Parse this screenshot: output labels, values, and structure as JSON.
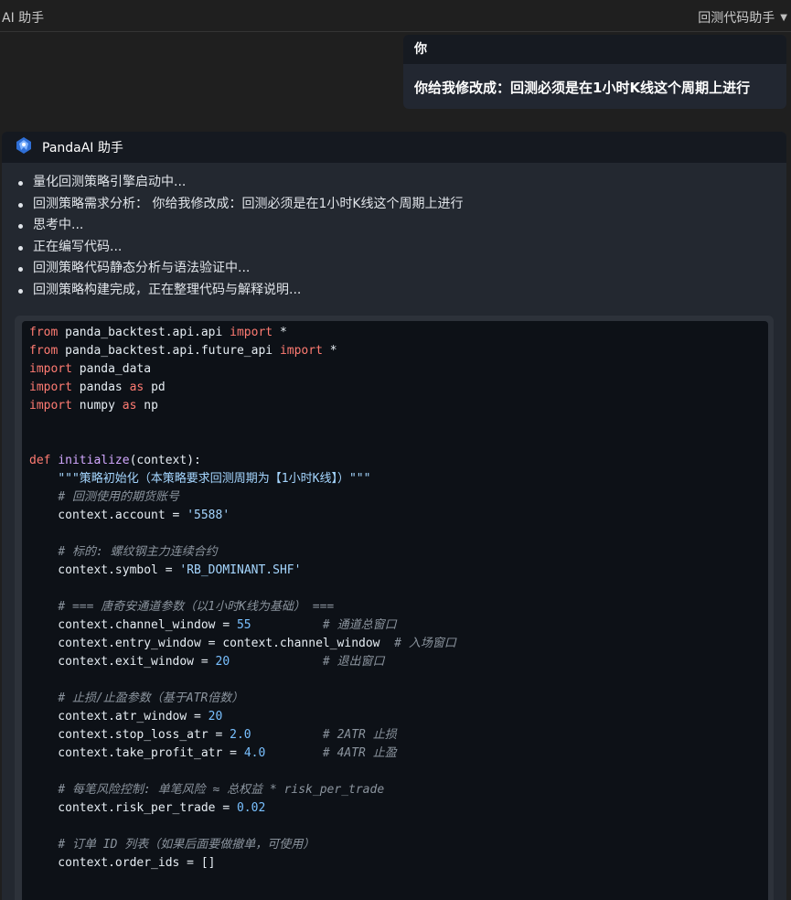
{
  "topbar": {
    "title": "AI 助手",
    "menu_label": "回测代码助手"
  },
  "user_message": {
    "author": "你",
    "text": "你给我修改成：回测必须是在1小时K线这个周期上进行"
  },
  "assistant": {
    "name": "PandaAI 助手",
    "steps": [
      "量化回测策略引擎启动中...",
      "回测策略需求分析： 你给我修改成：回测必须是在1小时K线这个周期上进行",
      "思考中...",
      "正在编写代码...",
      "回测策略代码静态分析与语法验证中...",
      "回测策略构建完成，正在整理代码与解释说明..."
    ]
  },
  "code_lines": [
    [
      {
        "t": "from",
        "c": "kw"
      },
      {
        "t": " panda_backtest.api.api "
      },
      {
        "t": "import",
        "c": "kw"
      },
      {
        "t": " *"
      }
    ],
    [
      {
        "t": "from",
        "c": "kw"
      },
      {
        "t": " panda_backtest.api.future_api "
      },
      {
        "t": "import",
        "c": "kw"
      },
      {
        "t": " *"
      }
    ],
    [
      {
        "t": "import",
        "c": "kw"
      },
      {
        "t": " panda_data"
      }
    ],
    [
      {
        "t": "import",
        "c": "kw"
      },
      {
        "t": " pandas "
      },
      {
        "t": "as",
        "c": "kw"
      },
      {
        "t": " pd"
      }
    ],
    [
      {
        "t": "import",
        "c": "kw"
      },
      {
        "t": " numpy "
      },
      {
        "t": "as",
        "c": "kw"
      },
      {
        "t": " np"
      }
    ],
    [],
    [],
    [
      {
        "t": "def",
        "c": "kw"
      },
      {
        "t": " "
      },
      {
        "t": "initialize",
        "c": "fn"
      },
      {
        "t": "(context):"
      }
    ],
    [
      {
        "t": "    "
      },
      {
        "t": "\"\"\"策略初始化（本策略要求回测周期为【1小时K线】）\"\"\"",
        "c": "str"
      }
    ],
    [
      {
        "t": "    "
      },
      {
        "t": "# 回测使用的期货账号",
        "c": "cm"
      }
    ],
    [
      {
        "t": "    context.account = "
      },
      {
        "t": "'5588'",
        "c": "str"
      }
    ],
    [],
    [
      {
        "t": "    "
      },
      {
        "t": "# 标的: 螺纹钢主力连续合约",
        "c": "cm"
      }
    ],
    [
      {
        "t": "    context.symbol = "
      },
      {
        "t": "'RB_DOMINANT.SHF'",
        "c": "str"
      }
    ],
    [],
    [
      {
        "t": "    "
      },
      {
        "t": "# === 唐奇安通道参数（以1小时K线为基础） ===",
        "c": "cm"
      }
    ],
    [
      {
        "t": "    context.channel_window = "
      },
      {
        "t": "55",
        "c": "num"
      },
      {
        "t": "          "
      },
      {
        "t": "# 通道总窗口",
        "c": "cm"
      }
    ],
    [
      {
        "t": "    context.entry_window = context.channel_window  "
      },
      {
        "t": "# 入场窗口",
        "c": "cm"
      }
    ],
    [
      {
        "t": "    context.exit_window = "
      },
      {
        "t": "20",
        "c": "num"
      },
      {
        "t": "             "
      },
      {
        "t": "# 退出窗口",
        "c": "cm"
      }
    ],
    [],
    [
      {
        "t": "    "
      },
      {
        "t": "# 止损/止盈参数（基于ATR倍数）",
        "c": "cm"
      }
    ],
    [
      {
        "t": "    context.atr_window = "
      },
      {
        "t": "20",
        "c": "num"
      }
    ],
    [
      {
        "t": "    context.stop_loss_atr = "
      },
      {
        "t": "2.0",
        "c": "num"
      },
      {
        "t": "          "
      },
      {
        "t": "# 2ATR 止损",
        "c": "cm"
      }
    ],
    [
      {
        "t": "    context.take_profit_atr = "
      },
      {
        "t": "4.0",
        "c": "num"
      },
      {
        "t": "        "
      },
      {
        "t": "# 4ATR 止盈",
        "c": "cm"
      }
    ],
    [],
    [
      {
        "t": "    "
      },
      {
        "t": "# 每笔风险控制: 单笔风险 ≈ 总权益 * risk_per_trade",
        "c": "cm"
      }
    ],
    [
      {
        "t": "    context.risk_per_trade = "
      },
      {
        "t": "0.02",
        "c": "num"
      }
    ],
    [],
    [
      {
        "t": "    "
      },
      {
        "t": "# 订单 ID 列表（如果后面要做撤单，可使用）",
        "c": "cm"
      }
    ],
    [
      {
        "t": "    context.order_ids = []"
      }
    ]
  ],
  "colors": {
    "keyword": "#ff7b72",
    "function": "#d2a8ff",
    "string": "#a5d6ff",
    "number": "#79c0ff",
    "comment": "#8b949e"
  }
}
